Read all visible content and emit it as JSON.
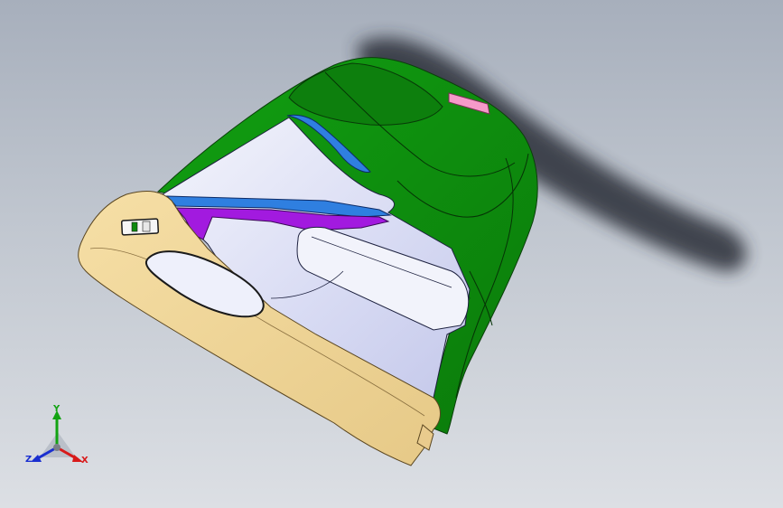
{
  "viewport": {
    "background_top": "#a7afbc",
    "background_bottom": "#dcdfe4"
  },
  "model": {
    "colors": {
      "shell": "#0e8a0e",
      "shell_dark": "#0a6e0a",
      "bezel": "#f0d79c",
      "bezel_dark": "#c9a86a",
      "inner_face": "#d9dcf4",
      "inner_face_light": "#f2f3fb",
      "channel": "#2f7fe0",
      "rib": "#a21adf",
      "pad": "#f59ac9",
      "shadow": "#2a2f38"
    }
  },
  "triad": {
    "y_label": "Y",
    "z_label": "Z",
    "x_label": "X",
    "colors": {
      "y": "#12a312",
      "z": "#1a2fd0",
      "x": "#d81a1a"
    }
  }
}
